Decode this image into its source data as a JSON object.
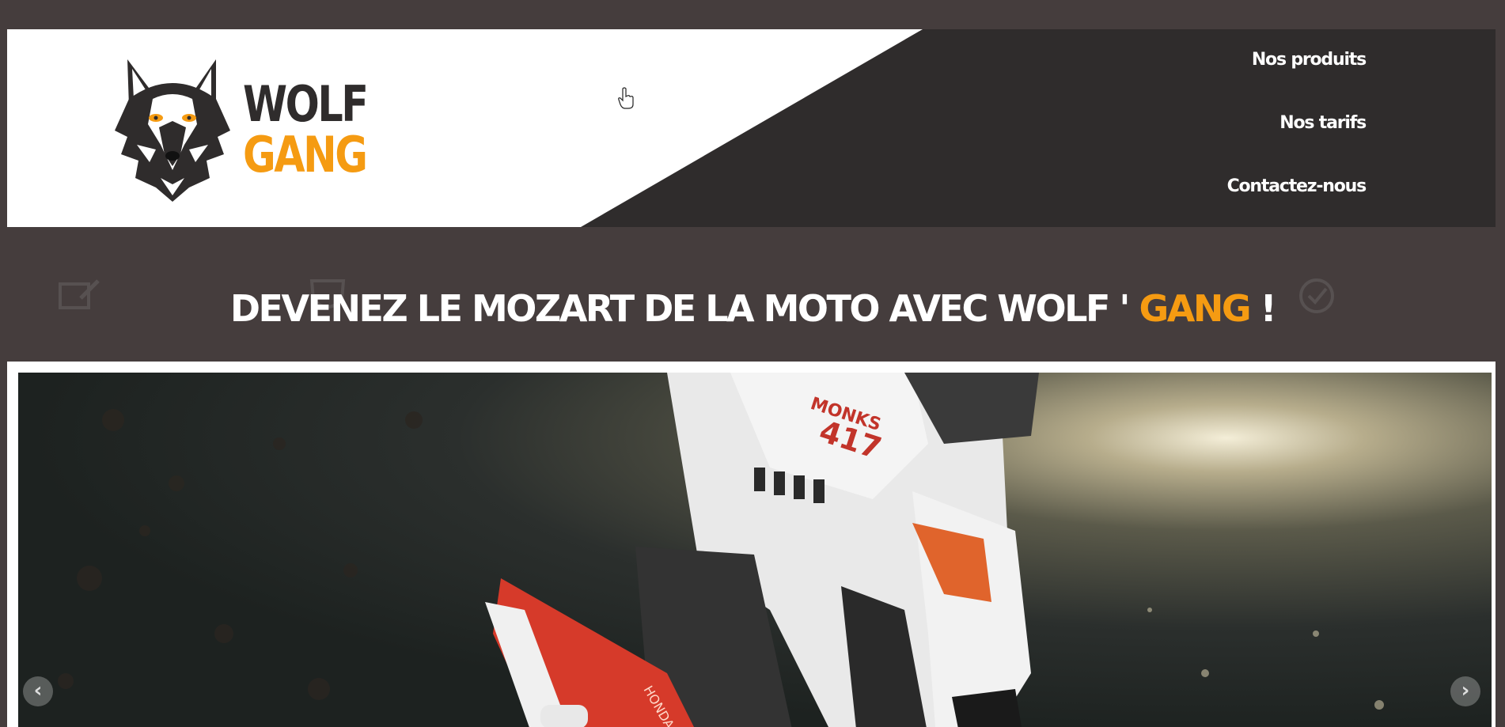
{
  "brand": {
    "word1": "WOLF",
    "word2": "GANG",
    "accent_color": "#f59b12",
    "dark_color": "#2f2c2c"
  },
  "nav": {
    "items": [
      {
        "label": "Nos produits"
      },
      {
        "label": "Nos tarifs"
      },
      {
        "label": "Contactez-nous"
      }
    ]
  },
  "hero": {
    "headline_main": "DEVENEZ LE MOZART DE LA MOTO AVEC WOLF ' ",
    "headline_accent": "GANG",
    "headline_end": " !"
  },
  "slider": {
    "prev_icon": "chevron-left-icon",
    "next_icon": "chevron-right-icon",
    "prev_glyph": "‹",
    "next_glyph": "›",
    "rider_number": "417",
    "rider_name": "MONKS",
    "bike_brand": "HONDA"
  },
  "colors": {
    "background": "#453d3d",
    "header_dark": "#2f2c2c",
    "text": "#ffffff"
  }
}
